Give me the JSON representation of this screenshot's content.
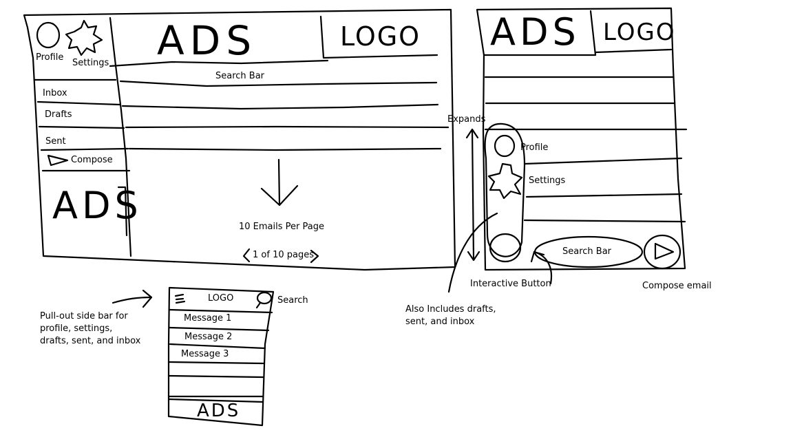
{
  "desktop": {
    "ads_top": "ADS",
    "logo": "LOGO",
    "profile": "Profile",
    "settings": "Settings",
    "search_bar": "Search Bar",
    "inbox": "Inbox",
    "drafts": "Drafts",
    "sent": "Sent",
    "compose": "Compose",
    "ads_side": "ADS",
    "emails_per_page": "10 Emails Per Page",
    "pagination": "1 of 10 pages"
  },
  "tablet": {
    "ads": "ADS",
    "logo": "LOGO",
    "expands": "Expands",
    "profile": "Profile",
    "settings": "Settings",
    "search_bar": "Search Bar",
    "interactive_button": "Interactive Button",
    "compose_email": "Compose email",
    "also_includes": "Also Includes drafts,\nsent, and inbox"
  },
  "mobile": {
    "logo": "LOGO",
    "search": "Search",
    "messages": [
      "Message 1",
      "Message 2",
      "Message 3"
    ],
    "ads": "ADS",
    "note": "Pull-out side bar for\nprofile, settings,\ndrafts, sent, and inbox"
  }
}
